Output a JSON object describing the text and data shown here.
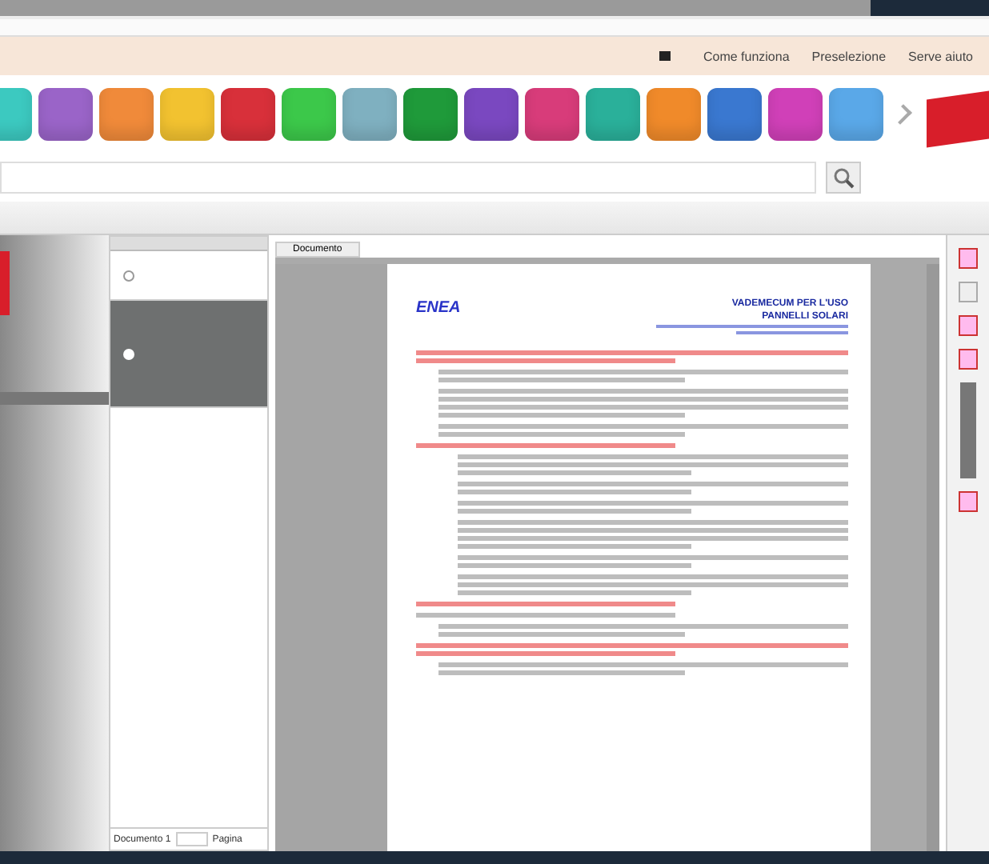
{
  "header": {
    "links": [
      "Come funziona",
      "Preselezione",
      "Serve aiuto"
    ]
  },
  "tiles": [
    {
      "color": "#3cc9c0"
    },
    {
      "color": "#9a64c8"
    },
    {
      "color": "#f08a3a"
    },
    {
      "color": "#f2c230"
    },
    {
      "color": "#d8303a"
    },
    {
      "color": "#3cc84a"
    },
    {
      "color": "#7fb0c0"
    },
    {
      "color": "#1f9a3a"
    },
    {
      "color": "#7a48c0"
    },
    {
      "color": "#d83c7a"
    },
    {
      "color": "#2ab09a"
    },
    {
      "color": "#f08a2a"
    },
    {
      "color": "#3a78d0"
    },
    {
      "color": "#d040b8"
    },
    {
      "color": "#5aa8e8"
    }
  ],
  "results": [
    {
      "selected": false
    },
    {
      "selected": true
    }
  ],
  "viewer": {
    "tab": "Documento",
    "logo": "ENEA",
    "title_lines": [
      "VADEMECUM PER L'USO",
      "PANNELLI SOLARI"
    ]
  },
  "footer": {
    "document": "Documento 1",
    "page": "Pagina"
  }
}
